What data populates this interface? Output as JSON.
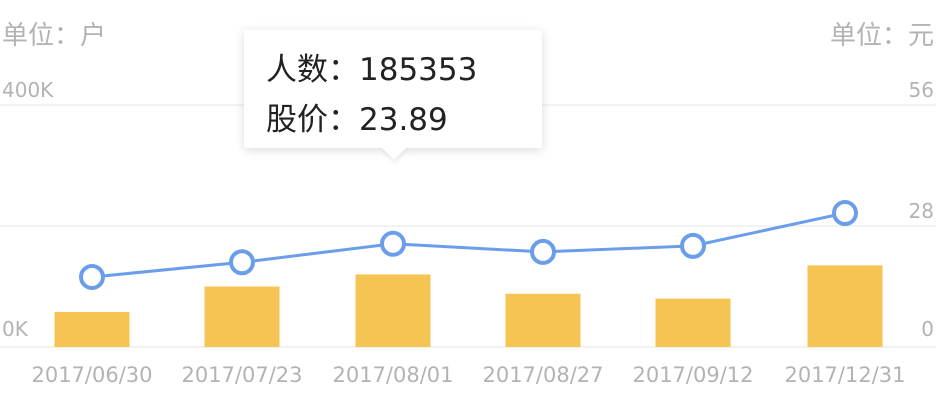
{
  "chart_data": {
    "type": "bar+line",
    "left_unit_label": "单位：户",
    "right_unit_label": "单位：元",
    "categories": [
      "2017/06/30",
      "2017/07/23",
      "2017/08/01",
      "2017/08/27",
      "2017/09/12",
      "2017/12/31"
    ],
    "series": [
      {
        "name": "人数",
        "type": "bar",
        "axis": "left",
        "color": "#F5C453",
        "values": [
          58000,
          100000,
          120000,
          88000,
          80000,
          135000
        ]
      },
      {
        "name": "股价",
        "type": "line",
        "axis": "right",
        "color": "#6A9EEB",
        "values": [
          16.2,
          19.6,
          23.89,
          22.0,
          23.4,
          31.0
        ]
      }
    ],
    "left_axis": {
      "min": 0,
      "max": 400000,
      "tick_labels": [
        "400K",
        "0K"
      ]
    },
    "right_axis": {
      "min": 0,
      "max": 56,
      "tick_labels": [
        "56",
        "28",
        "0"
      ]
    },
    "grid": true
  },
  "tooltip": {
    "row1_label": "人数：",
    "row1_value": "185353",
    "row2_label": "股价：",
    "row2_value": "23.89"
  }
}
